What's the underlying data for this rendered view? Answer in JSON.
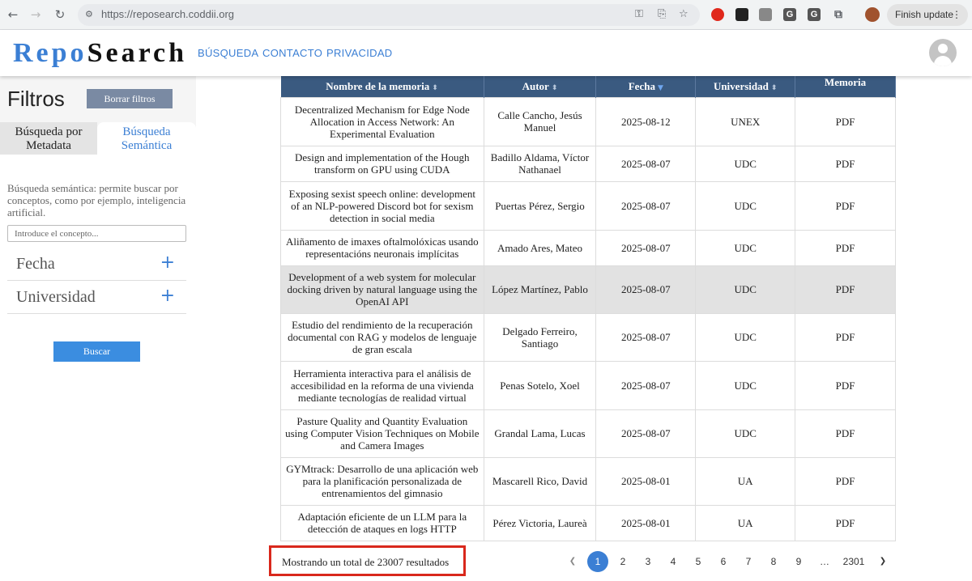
{
  "browser": {
    "url": "https://reposearch.coddii.org",
    "finish_update": "Finish update",
    "ext_g1": "G",
    "ext_g2": "G"
  },
  "site": {
    "logo_repo": "Repo",
    "logo_search": "Search",
    "nav": [
      "BÚSQUEDA",
      "CONTACTO",
      "PRIVACIDAD"
    ]
  },
  "sidebar": {
    "title": "Filtros",
    "clear_button": "Borrar filtros",
    "tab_metadata": "Búsqueda por Metadata",
    "tab_semantic": "Búsqueda Semántica",
    "semantic_description": "Búsqueda semántica: permite buscar por conceptos, como por ejemplo, inteligencia artificial.",
    "concept_placeholder": "Introduce el concepto...",
    "filters": [
      "Fecha",
      "Universidad"
    ],
    "search_button": "Buscar"
  },
  "table": {
    "headers": [
      "Nombre de la memoria",
      "Autor",
      "Fecha",
      "Universidad",
      "Memoria"
    ],
    "rows": [
      {
        "title": "Decentralized Mechanism for Edge Node Allocation in Access Network: An Experimental Evaluation",
        "author": "Calle Cancho, Jesús Manuel",
        "date": "2025-08-12",
        "university": "UNEX",
        "link": "PDF"
      },
      {
        "title": "Design and implementation of the Hough transform on GPU using CUDA",
        "author": "Badillo Aldama, Víctor Nathanael",
        "date": "2025-08-07",
        "university": "UDC",
        "link": "PDF"
      },
      {
        "title": "Exposing sexist speech online: development of an NLP-powered Discord bot for sexism detection in social media",
        "author": "Puertas Pérez, Sergio",
        "date": "2025-08-07",
        "university": "UDC",
        "link": "PDF"
      },
      {
        "title": "Aliñamento de imaxes oftalmolóxicas usando representacións neuronais implícitas",
        "author": "Amado Ares, Mateo",
        "date": "2025-08-07",
        "university": "UDC",
        "link": "PDF"
      },
      {
        "title": "Development of a web system for molecular docking driven by natural language using the OpenAI API",
        "author": "López Martínez, Pablo",
        "date": "2025-08-07",
        "university": "UDC",
        "link": "PDF"
      },
      {
        "title": "Estudio del rendimiento de la recuperación documental con RAG y modelos de lenguaje de gran escala",
        "author": "Delgado Ferreiro, Santiago",
        "date": "2025-08-07",
        "university": "UDC",
        "link": "PDF"
      },
      {
        "title": "Herramienta interactiva para el análisis de accesibilidad en la reforma de una vivienda mediante tecnologías de realidad virtual",
        "author": "Penas Sotelo, Xoel",
        "date": "2025-08-07",
        "university": "UDC",
        "link": "PDF"
      },
      {
        "title": "Pasture Quality and Quantity Evaluation using Computer Vision Techniques on Mobile and Camera Images",
        "author": "Grandal Lama, Lucas",
        "date": "2025-08-07",
        "university": "UDC",
        "link": "PDF"
      },
      {
        "title": "GYMtrack: Desarrollo de una aplicación web para la planificación personalizada de entrenamientos del gimnasio",
        "author": "Mascarell Rico, David",
        "date": "2025-08-01",
        "university": "UA",
        "link": "PDF"
      },
      {
        "title": "Adaptación eficiente de un LLM para la detección de ataques en logs HTTP",
        "author": "Pérez Victoria, Laureà",
        "date": "2025-08-01",
        "university": "UA",
        "link": "PDF"
      }
    ]
  },
  "results_summary": "Mostrando un total de 23007 resultados",
  "pagination": {
    "pages": [
      "1",
      "2",
      "3",
      "4",
      "5",
      "6",
      "7",
      "8",
      "9",
      "…",
      "2301"
    ],
    "current": "1"
  }
}
